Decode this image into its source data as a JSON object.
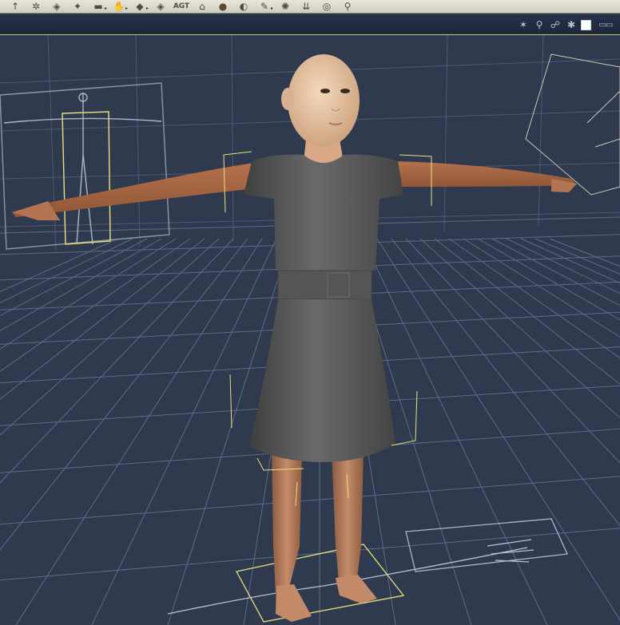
{
  "toolbar": {
    "tools": [
      {
        "name": "rotate-tool",
        "glyph": "↑",
        "sub": ""
      },
      {
        "name": "twist-tool",
        "glyph": "✲",
        "sub": ""
      },
      {
        "name": "translate-tool",
        "glyph": "◈",
        "sub": ""
      },
      {
        "name": "direct-manipulation-tool",
        "glyph": "✦",
        "sub": ""
      },
      {
        "name": "scale-tool",
        "glyph": "▬",
        "sub": "▸"
      },
      {
        "name": "hand-tool",
        "glyph": "✋",
        "sub": "▸"
      },
      {
        "name": "morph-tool",
        "glyph": "◆",
        "sub": "▸"
      },
      {
        "name": "grouping-tool",
        "glyph": "◈",
        "sub": ""
      },
      {
        "name": "text-tool",
        "glyph": "AGT",
        "sub": "",
        "text": true
      },
      {
        "name": "house-tool",
        "glyph": "⌂",
        "sub": ""
      },
      {
        "name": "sphere-tool",
        "glyph": "●",
        "sub": ""
      },
      {
        "name": "cloth-tool",
        "glyph": "◐",
        "sub": ""
      },
      {
        "name": "bone-tool",
        "glyph": "✎",
        "sub": "▸"
      },
      {
        "name": "joint-tool",
        "glyph": "✺",
        "sub": ""
      },
      {
        "name": "chain-tool",
        "glyph": "⇊",
        "sub": ""
      },
      {
        "name": "target-tool",
        "glyph": "◎",
        "sub": ""
      },
      {
        "name": "wand-tool",
        "glyph": "⚲",
        "sub": ""
      }
    ]
  },
  "viewport_controls": [
    {
      "name": "light-icon",
      "glyph": "✶"
    },
    {
      "name": "camera-icon",
      "glyph": "⚲"
    },
    {
      "name": "figure-icon",
      "glyph": "☍"
    },
    {
      "name": "target-icon",
      "glyph": "✱"
    }
  ],
  "colors": {
    "background": "#2f3a4f",
    "grid": "#5d6b86",
    "bounding_box": "#e7e27a",
    "dress": "#5e5e5e",
    "skin": "#b57a55",
    "head": "#e7c8a8"
  }
}
